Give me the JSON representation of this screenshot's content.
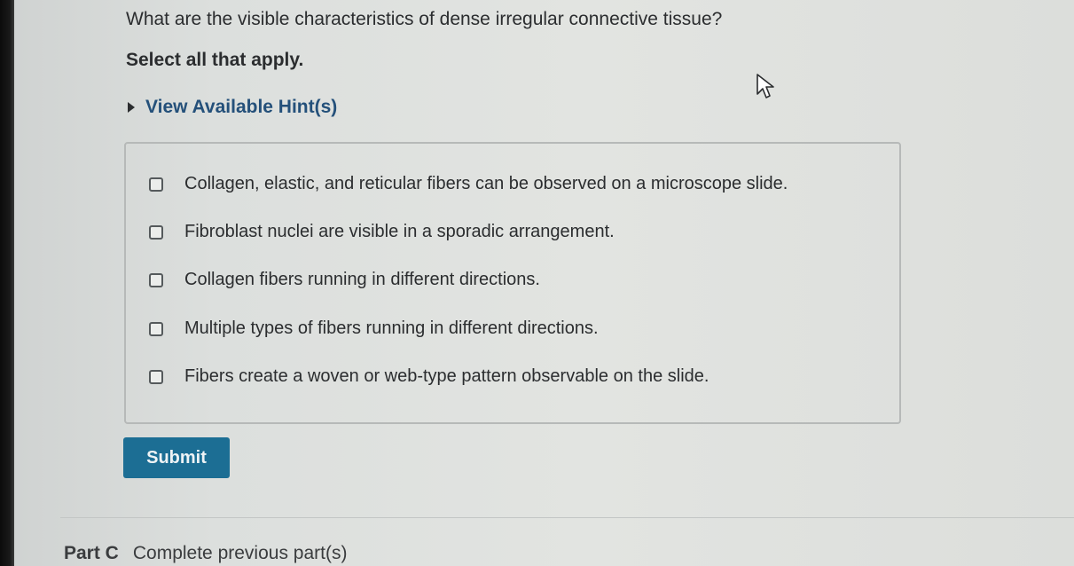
{
  "question": {
    "text": "What are the visible characteristics of dense irregular connective tissue?",
    "instruction": "Select all that apply."
  },
  "hints": {
    "label": "View Available Hint(s)",
    "icon": "caret-right-icon"
  },
  "options": [
    {
      "label": "Collagen, elastic, and reticular fibers can be observed on a microscope slide.",
      "checked": false
    },
    {
      "label": "Fibroblast nuclei are visible in a sporadic arrangement.",
      "checked": false
    },
    {
      "label": "Collagen fibers running in different directions.",
      "checked": false
    },
    {
      "label": "Multiple types of fibers running in different directions.",
      "checked": false
    },
    {
      "label": "Fibers create a woven or web-type pattern observable on the slide.",
      "checked": false
    }
  ],
  "submit": {
    "label": "Submit",
    "color": "#1c6e94"
  },
  "next_part": {
    "label": "Part C",
    "status": "Complete previous part(s)"
  }
}
